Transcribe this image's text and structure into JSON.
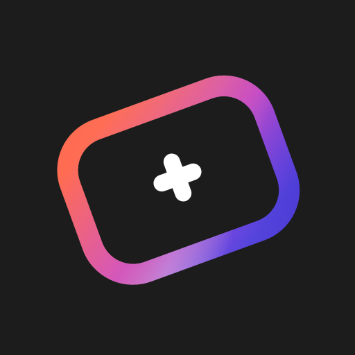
{
  "app_icon": {
    "name": "add-media-app-icon",
    "background_color": "#1c1c1c",
    "frame_gradient": [
      "#ff6a4d",
      "#ffc48a",
      "#c7c3e8",
      "#4c3cd8",
      "#a53ad6",
      "#e04aa8"
    ],
    "inner_color": "#1c1c1c",
    "plus_color": "#ffffff",
    "icons": {
      "frame": "rounded-rectangle-frame-icon",
      "plus": "plus-icon"
    }
  }
}
